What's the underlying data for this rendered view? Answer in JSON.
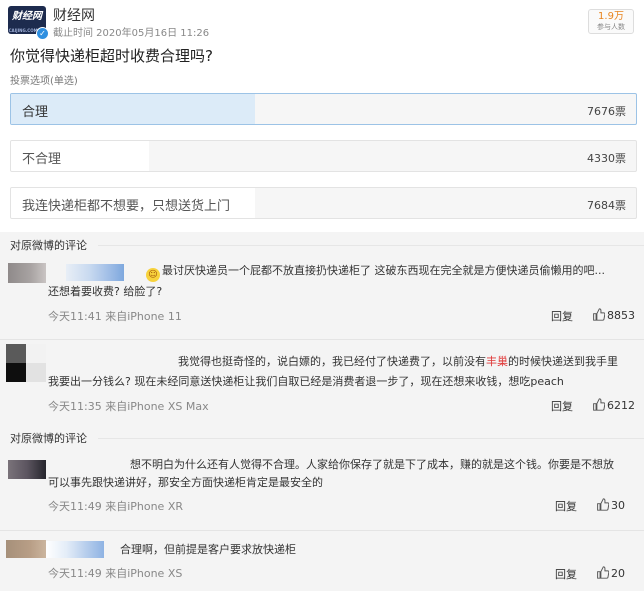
{
  "header": {
    "logo_text": "财经网",
    "logo_sub": "CAIJING.COM.CN",
    "source_name": "财经网",
    "deadline": "截止时间 2020年05月16日 11:26",
    "participants_count": "1.9万",
    "participants_label": "参与人数"
  },
  "poll": {
    "question": "你觉得快递柜超时收费合理吗?",
    "vote_type": "投票选项(单选)",
    "options": [
      {
        "label": "合理",
        "count": "7676票",
        "share": 0.39,
        "selected": true
      },
      {
        "label": "不合理",
        "count": "4330票",
        "share": 0.22,
        "selected": false
      },
      {
        "label": "我连快递柜都不想要，只想送货上门",
        "count": "7684票",
        "share": 0.39,
        "selected": false
      }
    ]
  },
  "comments_section": {
    "title": "对原微博的评论",
    "comments": [
      {
        "text_line1": "最讨厌快递员一个屁都不放直接扔快递柜了 这破东西现在完全就是方便快递员偷懒用的吧...",
        "text_line2": "还想着要收费? 给脸了?",
        "time": "今天11:41 来自iPhone 11",
        "reply": "回复",
        "likes": "8853"
      },
      {
        "text_line1_a": "我觉得也挺奇怪的，说白嫖的，我已经付了快递费了，以前没有",
        "text_line1_hl": "丰巢",
        "text_line1_b": "的时候快递送到我手里",
        "text_line2": "我要出一分钱么? 现在未经同意送快递柜让我们自取已经是消费者退一步了，现在还想来收钱，想吃peach",
        "time": "今天11:35 来自iPhone XS Max",
        "reply": "回复",
        "likes": "6212"
      }
    ]
  },
  "comments_section_2": {
    "title": "对原微博的评论",
    "comments": [
      {
        "text_line1": "想不明白为什么还有人觉得不合理。人家给你保存了就是下了成本，赚的就是这个钱。你要是不想放",
        "text_line2": "可以事先跟快递讲好，那安全方面快递柜肯定是最安全的",
        "time": "今天11:49 来自iPhone XR",
        "reply": "回复",
        "likes": "30"
      },
      {
        "text_line1": "合理啊，但前提是客户要求放快递柜",
        "time": "今天11:49 来自iPhone XS",
        "reply": "回复",
        "likes": "20"
      }
    ]
  }
}
